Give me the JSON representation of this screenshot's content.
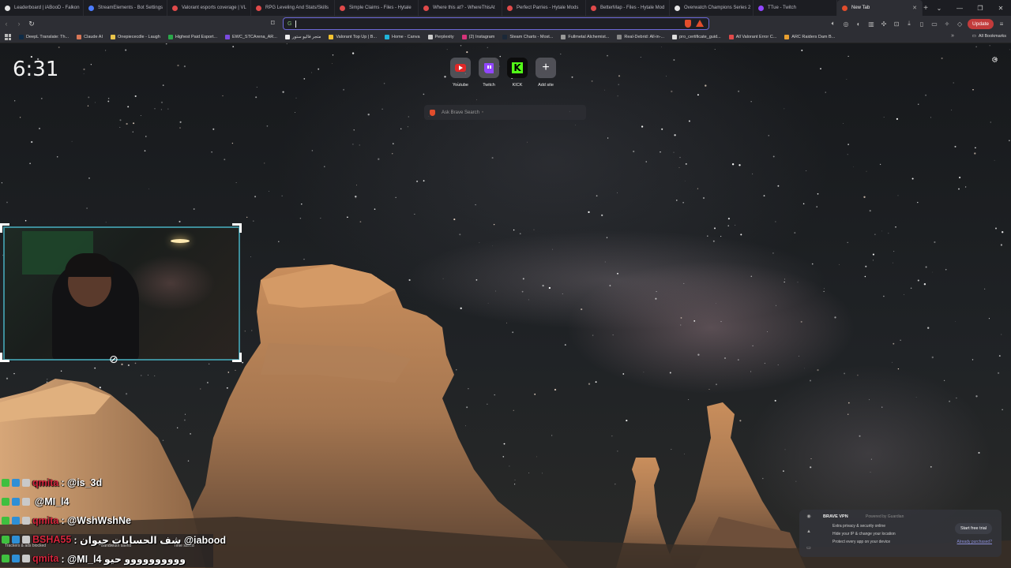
{
  "tabs": [
    {
      "title": "Leaderboard | iABooD - Falkon",
      "color": "#e4e4e4"
    },
    {
      "title": "StreamElements - Bot Settings",
      "color": "#4b7cff"
    },
    {
      "title": "Valorant esports coverage | VL",
      "color": "#e04a4a"
    },
    {
      "title": "RPG Leveling And Stats/Skills",
      "color": "#e04a4a"
    },
    {
      "title": "Simple Claims - Files - Hytale",
      "color": "#e04a4a"
    },
    {
      "title": "Where this at? - WhereThisAt",
      "color": "#e04a4a"
    },
    {
      "title": "Perfect Parries - Hytale Mods",
      "color": "#e04a4a"
    },
    {
      "title": "BetterMap - Files - Hytale Mod",
      "color": "#e04a4a"
    },
    {
      "title": "Overwatch Champions Series 2",
      "color": "#e6e6e6"
    },
    {
      "title": "TTue - Twitch",
      "color": "#9146ff"
    },
    {
      "title": "New Tab",
      "color": "#e24d2c"
    }
  ],
  "toolbar": {
    "update_label": "Update",
    "url_value": ""
  },
  "bookmarks": [
    {
      "label": "DeepL Translate: Th...",
      "color": "#0f2b46"
    },
    {
      "label": "Claude AI",
      "color": "#d97757"
    },
    {
      "label": "Onepiececdle - Laugh",
      "color": "#e8c34a"
    },
    {
      "label": "Highest Paid Esport...",
      "color": "#2aa84a"
    },
    {
      "label": "EWC_STCArena_AR...",
      "color": "#7a4adf"
    },
    {
      "label": "متجر فاليو ستور",
      "color": "#eeeeee"
    },
    {
      "label": "Valorant Top Up | B...",
      "color": "#f2c230"
    },
    {
      "label": "Home - Canva",
      "color": "#20b4d8"
    },
    {
      "label": "Perplexity",
      "color": "#cccccc"
    },
    {
      "label": "(2) Instagram",
      "color": "#d6337a"
    },
    {
      "label": "Steam Charts - Most...",
      "color": "#1b2838"
    },
    {
      "label": "Fullmetal Alchemist...",
      "color": "#999999"
    },
    {
      "label": "Real-Debrid: All-in-...",
      "color": "#888888"
    },
    {
      "label": "pro_certificate_guid...",
      "color": "#dddddd"
    },
    {
      "label": "All Valorant Error C...",
      "color": "#e04a4a"
    },
    {
      "label": "ARC Raiders Dam B...",
      "color": "#e8a030"
    }
  ],
  "all_bookmarks_label": "All Bookmarks",
  "ntp": {
    "clock": "6:31",
    "tiles": [
      {
        "label": "Youtube",
        "icon": "youtube-icon"
      },
      {
        "label": "Twitch",
        "icon": "twitch-icon"
      },
      {
        "label": "KICK",
        "icon": "kick-icon"
      },
      {
        "label": "Add site",
        "icon": "plus-icon"
      }
    ],
    "search_placeholder": "Ask Brave Search"
  },
  "chat": [
    {
      "user": "qmita",
      "message": ": @is_3d"
    },
    {
      "user": "",
      "message": "@MI_l4"
    },
    {
      "user": "qmita",
      "message": ": @WshWshNe"
    },
    {
      "user": "BSHA55",
      "message": ": شف الحسابات حيوان @iabood"
    },
    {
      "user": "qmita",
      "message": ": @MI_l4 وووووووووو حيو"
    }
  ],
  "stats": {
    "trackers": "Trackers & ads blocked",
    "bandwidth": "Bandwidth saved",
    "time": "Time saved"
  },
  "vpn": {
    "title": "BRAVE VPN",
    "powered": "Powered by Guardian",
    "lines": [
      "Extra privacy & security online",
      "Hide your IP & change your location",
      "Protect every app on your device"
    ],
    "trial_label": "Start free trial",
    "already_label": "Already purchased?"
  }
}
